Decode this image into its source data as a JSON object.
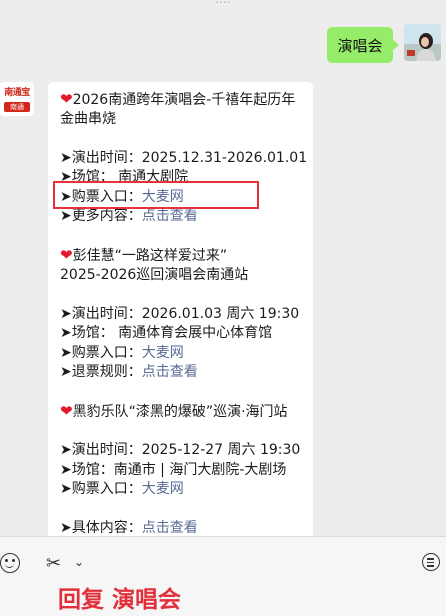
{
  "header": {
    "top_text": "...."
  },
  "user_message": {
    "text": "演唱会"
  },
  "bot": {
    "avatar_top": "南通宝",
    "avatar_bottom": "南通"
  },
  "concerts": [
    {
      "title_line1": "2026南通跨年演唱会-千禧年起历年",
      "title_line2": "金曲串烧",
      "time": "➤演出时间：2025.12.31-2026.01.01",
      "venue": "➤场馆：  南通大剧院",
      "ticket_label": "➤购票入口：",
      "ticket_link": "大麦网",
      "more_label": "➤更多内容：",
      "more_link": "点击查看"
    },
    {
      "title_line1": "彭佳慧“一路这样爱过来”",
      "title_line2": "2025-2026巡回演唱会南通站",
      "time": "➤演出时间：2026.01.03 周六 19:30",
      "venue": "➤场馆：  南通体育会展中心体育馆",
      "ticket_label": "➤购票入口：",
      "ticket_link": "大麦网",
      "refund_label": "➤退票规则：",
      "refund_link": "点击查看"
    },
    {
      "title_line1": "黑豹乐队“漆黑的爆破”巡演·海门站",
      "time": "➤演出时间：2025-12-27 周六 19:30",
      "venue": "➤场馆：南通市 | 海门大剧院-大剧场",
      "ticket_label": "➤购票入口：",
      "ticket_link": "大麦网",
      "detail_label": "➤具体内容：",
      "detail_link": "点击查看"
    }
  ],
  "bottom": {
    "reply_text": "回复 演唱会",
    "chevron": "⌄"
  },
  "colors": {
    "bubble_green": "#95ec69",
    "link": "#576b95",
    "highlight": "#e8313b",
    "reply": "#e2303a"
  }
}
